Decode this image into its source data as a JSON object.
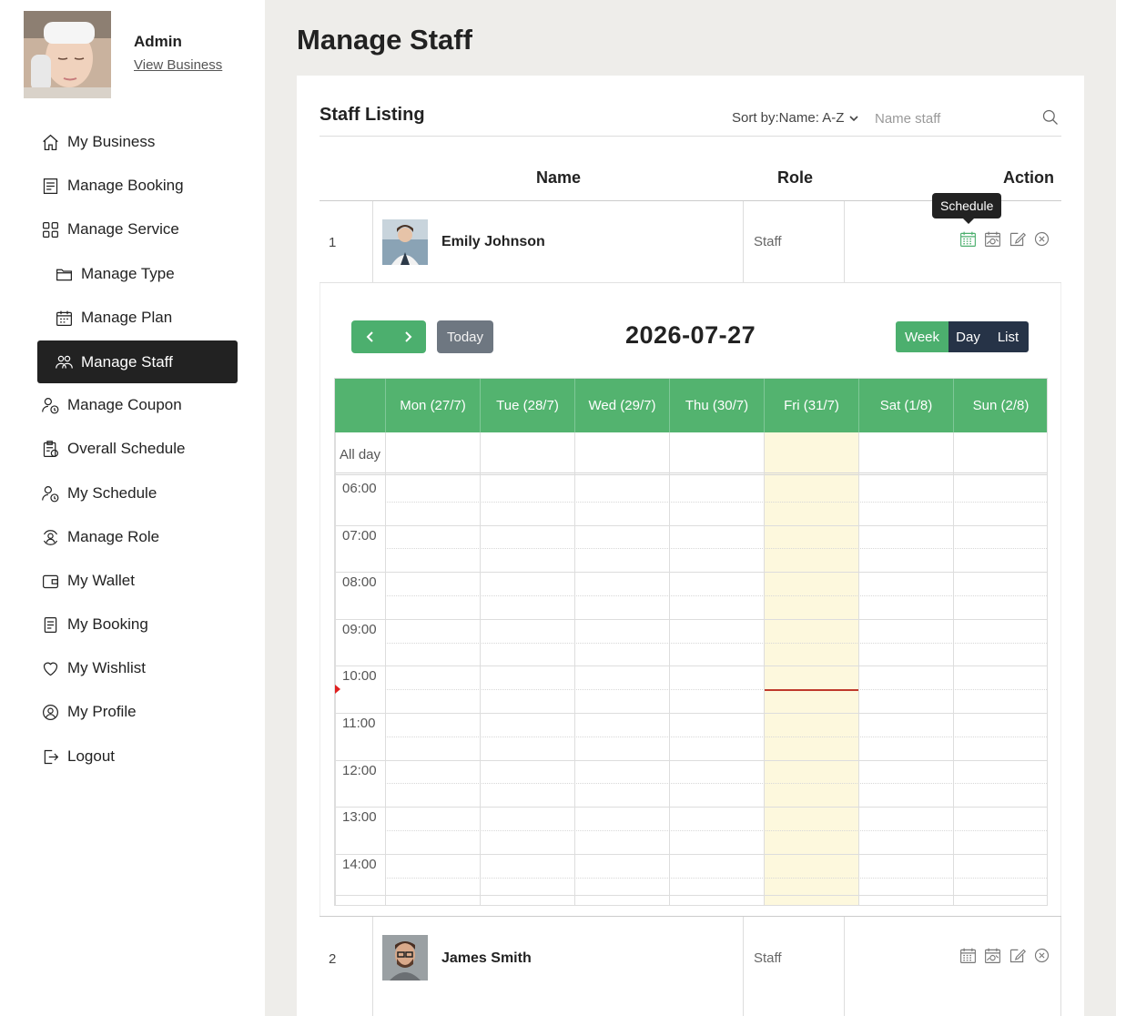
{
  "profile": {
    "name": "Admin",
    "link": "View Business"
  },
  "sidebar": {
    "items": [
      {
        "label": "My Business",
        "icon": "home-icon"
      },
      {
        "label": "Manage Booking",
        "icon": "booking-list-icon"
      },
      {
        "label": "Manage Service",
        "icon": "grid-icon"
      },
      {
        "label": "Manage Type",
        "icon": "folder-icon"
      },
      {
        "label": "Manage Plan",
        "icon": "calendar-plan-icon"
      },
      {
        "label": "Manage Staff",
        "icon": "staff-group-icon"
      },
      {
        "label": "Manage Coupon",
        "icon": "user-clock-icon"
      },
      {
        "label": "Overall Schedule",
        "icon": "schedule-clipboard-icon"
      },
      {
        "label": "My Schedule",
        "icon": "user-clock-icon"
      },
      {
        "label": "Manage Role",
        "icon": "role-icon"
      },
      {
        "label": "My Wallet",
        "icon": "wallet-icon"
      },
      {
        "label": "My Booking",
        "icon": "document-icon"
      },
      {
        "label": "My Wishlist",
        "icon": "heart-icon"
      },
      {
        "label": "My Profile",
        "icon": "user-circle-icon"
      },
      {
        "label": "Logout",
        "icon": "logout-icon"
      }
    ],
    "active": "Manage Staff"
  },
  "page": {
    "title": "Manage Staff"
  },
  "listing": {
    "title": "Staff Listing",
    "sort_label": "Sort by:Name: A-Z",
    "search_placeholder": "Name staff",
    "columns": {
      "name": "Name",
      "role": "Role",
      "action": "Action"
    },
    "rows": [
      {
        "index": "1",
        "name": "Emily Johnson",
        "role": "Staff"
      },
      {
        "index": "2",
        "name": "James Smith",
        "role": "Staff"
      }
    ],
    "tooltip": "Schedule"
  },
  "calendar": {
    "title": "2026-07-27",
    "today_label": "Today",
    "views": [
      "Week",
      "Day",
      "List"
    ],
    "active_view": "Week",
    "days": [
      "Mon (27/7)",
      "Tue (28/7)",
      "Wed (29/7)",
      "Thu (30/7)",
      "Fri (31/7)",
      "Sat (1/8)",
      "Sun (2/8)"
    ],
    "today_day": "Fri (31/7)",
    "allday_label": "All day",
    "times": [
      "06:00",
      "07:00",
      "08:00",
      "09:00",
      "10:00",
      "11:00",
      "12:00",
      "13:00",
      "14:00"
    ],
    "now_time": "10:30"
  },
  "colors": {
    "accent_green": "#4caf6e",
    "header_green": "#53b36f",
    "dark": "#222222",
    "today_bg": "#fdf8dd",
    "view_btn": "#263347"
  }
}
